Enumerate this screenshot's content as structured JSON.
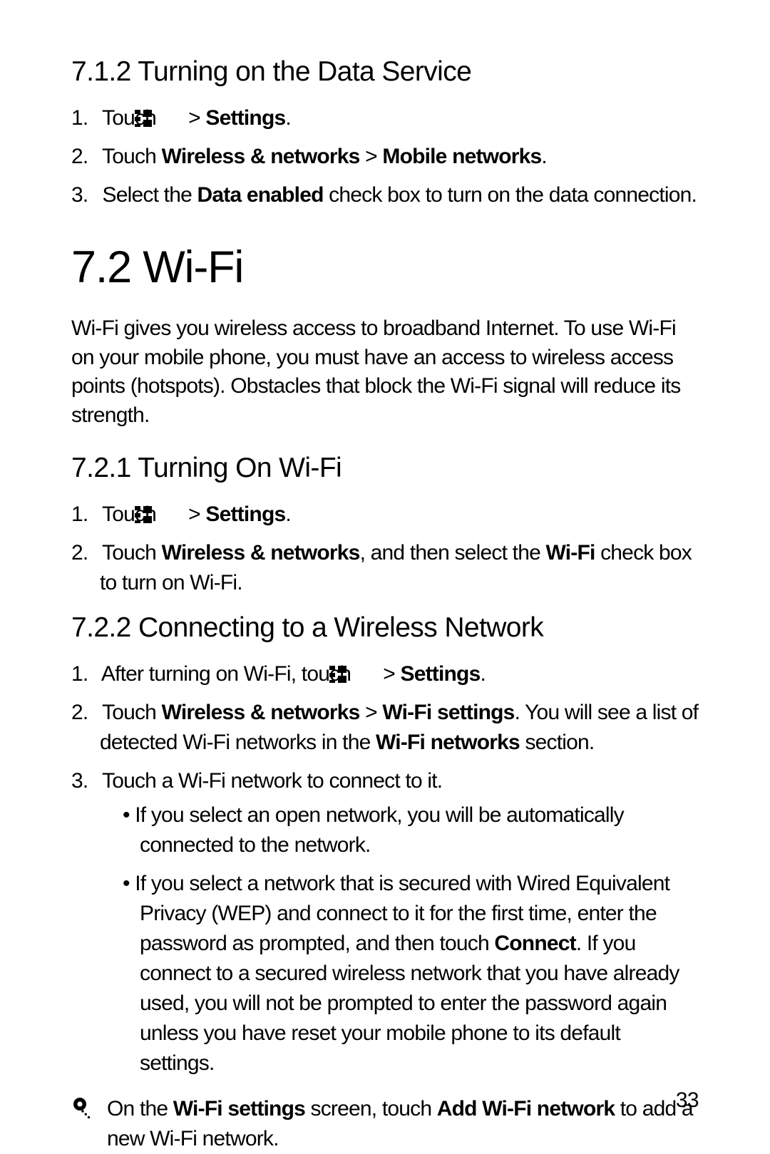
{
  "section_712": {
    "title": "7.1.2  Turning on the Data Service",
    "steps": [
      {
        "pre": "Touch ",
        "bold1": "Settings",
        "post": "."
      },
      {
        "pre": "Touch ",
        "bold1": "Wireless & networks",
        "sep": " > ",
        "bold2": "Mobile networks",
        "post": "."
      },
      {
        "pre": "Select the ",
        "bold1": "Data enabled",
        "post": " check box to turn on the data connection."
      }
    ]
  },
  "section_72": {
    "title": "7.2  Wi-Fi",
    "intro": "Wi-Fi gives you wireless access to broadband Internet. To use Wi-Fi on your mobile phone, you must have an access to wireless access points (hotspots). Obstacles that block the Wi-Fi signal will reduce its strength."
  },
  "section_721": {
    "title": "7.2.1  Turning On Wi-Fi",
    "steps": [
      {
        "pre": "Touch ",
        "bold1": "Settings",
        "post": "."
      },
      {
        "pre": "Touch ",
        "bold1": "Wireless & networks",
        "mid": ", and then select the ",
        "bold2": "Wi-Fi",
        "post": " check box to turn on Wi-Fi."
      }
    ]
  },
  "section_722": {
    "title": "7.2.2  Connecting to a Wireless Network",
    "step1": {
      "pre": "After turning on Wi-Fi, touch ",
      "bold1": "Settings",
      "post": "."
    },
    "step2": {
      "pre": "Touch ",
      "bold1": "Wireless & networks",
      "sep": " > ",
      "bold2": "Wi-Fi settings",
      "mid": ". You will see a list of detected Wi-Fi networks in the ",
      "bold3": "Wi-Fi networks",
      "post": " section."
    },
    "step3": {
      "text": "Touch a Wi-Fi network to connect to it."
    },
    "bullet1": "If you select an open network, you will be automatically connected to the network.",
    "bullet2": {
      "pre": "If you select a network that is secured with Wired Equivalent Privacy (WEP) and connect to it for the first time, enter the password as prompted, and then touch ",
      "bold1": "Connect",
      "post": ". If you connect to a secured wireless network that you have already used, you will not be prompted to enter the password again unless you have reset your mobile phone to its default settings."
    }
  },
  "note": {
    "pre": "On the ",
    "bold1": "Wi-Fi settings",
    "mid": " screen, touch ",
    "bold2": "Add Wi-Fi network",
    "post": " to add a new Wi-Fi network."
  },
  "page_number": "33"
}
